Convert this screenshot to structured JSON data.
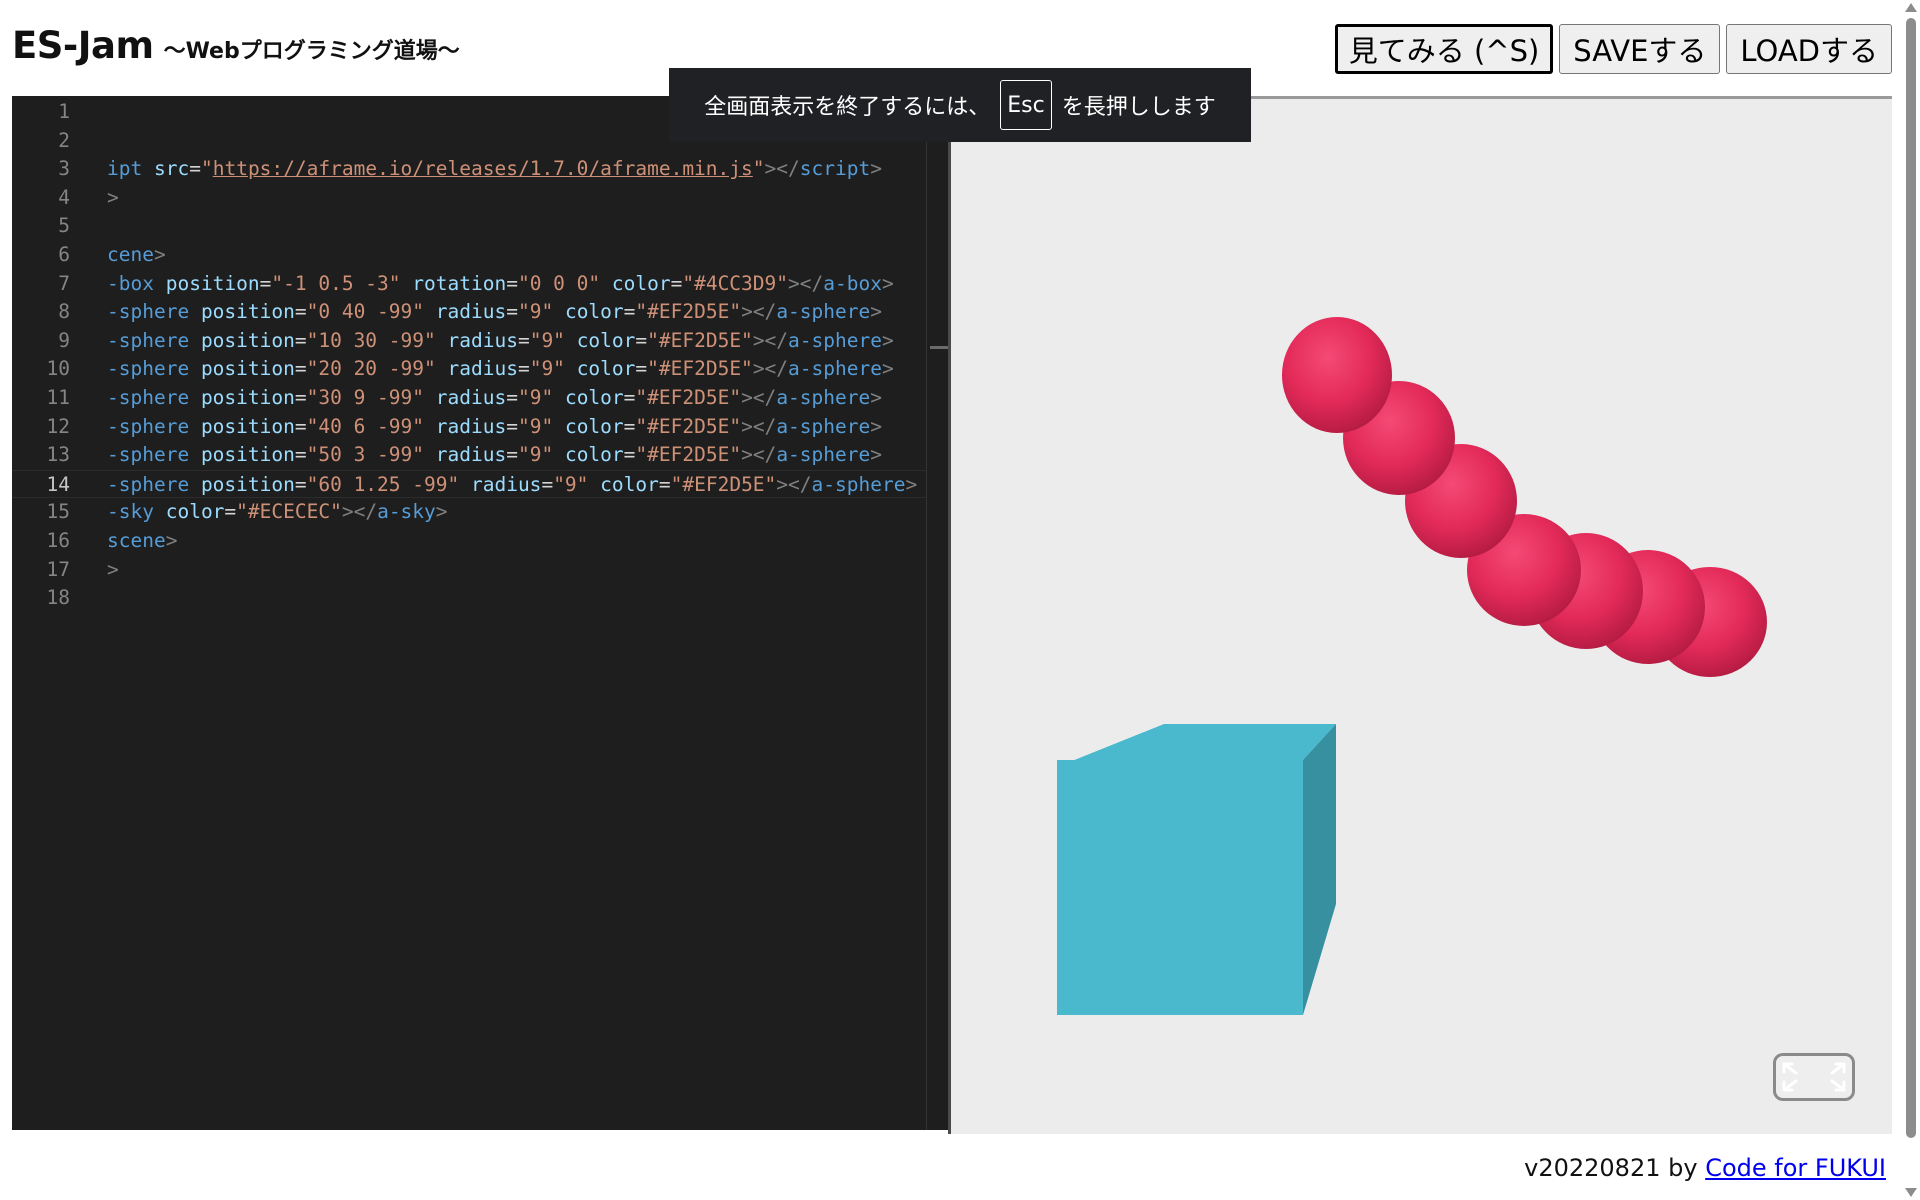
{
  "header": {
    "title": "ES-Jam",
    "subtitle": "～Webプログラミング道場～"
  },
  "toolbar": {
    "preview_label": "見てみる (^S)",
    "save_label": "SAVEする",
    "load_label": "LOADする"
  },
  "fullscreen_toast": {
    "before": "全画面表示を終了するには、",
    "key": "Esc",
    "after": "を長押しします"
  },
  "editor": {
    "current_line": 14,
    "line_numbers": [
      "1",
      "2",
      "3",
      "4",
      "5",
      "6",
      "7",
      "8",
      "9",
      "10",
      "11",
      "12",
      "13",
      "14",
      "15",
      "16",
      "17",
      "18"
    ],
    "lines": [
      [],
      [],
      [
        [
          "tag",
          "ipt"
        ],
        [
          "eq",
          " "
        ],
        [
          "attr",
          "src"
        ],
        [
          "eq",
          "="
        ],
        [
          "str",
          "\""
        ],
        [
          "url",
          "https://aframe.io/releases/1.7.0/aframe.min.js"
        ],
        [
          "str",
          "\""
        ],
        [
          "punc",
          "></"
        ],
        [
          "tag",
          "script"
        ],
        [
          "punc",
          ">"
        ]
      ],
      [
        [
          "punc",
          ">"
        ]
      ],
      [],
      [
        [
          "tag",
          "cene"
        ],
        [
          "punc",
          ">"
        ]
      ],
      [
        [
          "tag",
          "-box"
        ],
        [
          "eq",
          " "
        ],
        [
          "attr",
          "position"
        ],
        [
          "eq",
          "="
        ],
        [
          "str",
          "\"-1 0.5 -3\""
        ],
        [
          "eq",
          " "
        ],
        [
          "attr",
          "rotation"
        ],
        [
          "eq",
          "="
        ],
        [
          "str",
          "\"0 0 0\""
        ],
        [
          "eq",
          " "
        ],
        [
          "attr",
          "color"
        ],
        [
          "eq",
          "="
        ],
        [
          "str",
          "\"#4CC3D9\""
        ],
        [
          "punc",
          "></"
        ],
        [
          "tag",
          "a-box"
        ],
        [
          "punc",
          ">"
        ]
      ],
      [
        [
          "tag",
          "-sphere"
        ],
        [
          "eq",
          " "
        ],
        [
          "attr",
          "position"
        ],
        [
          "eq",
          "="
        ],
        [
          "str",
          "\"0 40 -99\""
        ],
        [
          "eq",
          " "
        ],
        [
          "attr",
          "radius"
        ],
        [
          "eq",
          "="
        ],
        [
          "str",
          "\"9\""
        ],
        [
          "eq",
          " "
        ],
        [
          "attr",
          "color"
        ],
        [
          "eq",
          "="
        ],
        [
          "str",
          "\"#EF2D5E\""
        ],
        [
          "punc",
          "></"
        ],
        [
          "tag",
          "a-sphere"
        ],
        [
          "punc",
          ">"
        ]
      ],
      [
        [
          "tag",
          "-sphere"
        ],
        [
          "eq",
          " "
        ],
        [
          "attr",
          "position"
        ],
        [
          "eq",
          "="
        ],
        [
          "str",
          "\"10 30 -99\""
        ],
        [
          "eq",
          " "
        ],
        [
          "attr",
          "radius"
        ],
        [
          "eq",
          "="
        ],
        [
          "str",
          "\"9\""
        ],
        [
          "eq",
          " "
        ],
        [
          "attr",
          "color"
        ],
        [
          "eq",
          "="
        ],
        [
          "str",
          "\"#EF2D5E\""
        ],
        [
          "punc",
          "></"
        ],
        [
          "tag",
          "a-sphere"
        ],
        [
          "punc",
          ">"
        ]
      ],
      [
        [
          "tag",
          "-sphere"
        ],
        [
          "eq",
          " "
        ],
        [
          "attr",
          "position"
        ],
        [
          "eq",
          "="
        ],
        [
          "str",
          "\"20 20 -99\""
        ],
        [
          "eq",
          " "
        ],
        [
          "attr",
          "radius"
        ],
        [
          "eq",
          "="
        ],
        [
          "str",
          "\"9\""
        ],
        [
          "eq",
          " "
        ],
        [
          "attr",
          "color"
        ],
        [
          "eq",
          "="
        ],
        [
          "str",
          "\"#EF2D5E\""
        ],
        [
          "punc",
          "></"
        ],
        [
          "tag",
          "a-sphere"
        ],
        [
          "punc",
          ">"
        ]
      ],
      [
        [
          "tag",
          "-sphere"
        ],
        [
          "eq",
          " "
        ],
        [
          "attr",
          "position"
        ],
        [
          "eq",
          "="
        ],
        [
          "str",
          "\"30 9 -99\""
        ],
        [
          "eq",
          " "
        ],
        [
          "attr",
          "radius"
        ],
        [
          "eq",
          "="
        ],
        [
          "str",
          "\"9\""
        ],
        [
          "eq",
          " "
        ],
        [
          "attr",
          "color"
        ],
        [
          "eq",
          "="
        ],
        [
          "str",
          "\"#EF2D5E\""
        ],
        [
          "punc",
          "></"
        ],
        [
          "tag",
          "a-sphere"
        ],
        [
          "punc",
          ">"
        ]
      ],
      [
        [
          "tag",
          "-sphere"
        ],
        [
          "eq",
          " "
        ],
        [
          "attr",
          "position"
        ],
        [
          "eq",
          "="
        ],
        [
          "str",
          "\"40 6 -99\""
        ],
        [
          "eq",
          " "
        ],
        [
          "attr",
          "radius"
        ],
        [
          "eq",
          "="
        ],
        [
          "str",
          "\"9\""
        ],
        [
          "eq",
          " "
        ],
        [
          "attr",
          "color"
        ],
        [
          "eq",
          "="
        ],
        [
          "str",
          "\"#EF2D5E\""
        ],
        [
          "punc",
          "></"
        ],
        [
          "tag",
          "a-sphere"
        ],
        [
          "punc",
          ">"
        ]
      ],
      [
        [
          "tag",
          "-sphere"
        ],
        [
          "eq",
          " "
        ],
        [
          "attr",
          "position"
        ],
        [
          "eq",
          "="
        ],
        [
          "str",
          "\"50 3 -99\""
        ],
        [
          "eq",
          " "
        ],
        [
          "attr",
          "radius"
        ],
        [
          "eq",
          "="
        ],
        [
          "str",
          "\"9\""
        ],
        [
          "eq",
          " "
        ],
        [
          "attr",
          "color"
        ],
        [
          "eq",
          "="
        ],
        [
          "str",
          "\"#EF2D5E\""
        ],
        [
          "punc",
          "></"
        ],
        [
          "tag",
          "a-sphere"
        ],
        [
          "punc",
          ">"
        ]
      ],
      [
        [
          "tag",
          "-sphere"
        ],
        [
          "eq",
          " "
        ],
        [
          "attr",
          "position"
        ],
        [
          "eq",
          "="
        ],
        [
          "str",
          "\"60 1.25 -99\""
        ],
        [
          "eq",
          " "
        ],
        [
          "attr",
          "radius"
        ],
        [
          "eq",
          "="
        ],
        [
          "str",
          "\"9\""
        ],
        [
          "eq",
          " "
        ],
        [
          "attr",
          "color"
        ],
        [
          "eq",
          "="
        ],
        [
          "str",
          "\"#EF2D5E\""
        ],
        [
          "punc",
          "></"
        ],
        [
          "tag",
          "a-sphere"
        ],
        [
          "punc",
          ">"
        ]
      ],
      [
        [
          "tag",
          "-sky"
        ],
        [
          "eq",
          " "
        ],
        [
          "attr",
          "color"
        ],
        [
          "eq",
          "="
        ],
        [
          "str",
          "\"#ECECEC\""
        ],
        [
          "punc",
          "></"
        ],
        [
          "tag",
          "a-sky"
        ],
        [
          "punc",
          ">"
        ]
      ],
      [
        [
          "tag",
          "scene"
        ],
        [
          "punc",
          ">"
        ]
      ],
      [
        [
          "punc",
          ">"
        ]
      ],
      []
    ]
  },
  "preview": {
    "sky_color": "#ECECEC",
    "box_color": "#4CC3D9",
    "sphere_color": "#EF2D5E"
  },
  "icons": {
    "fullscreen": "expand-arrows-icon"
  },
  "footer": {
    "version": "v20220821 by ",
    "link_text": "Code for FUKUI"
  }
}
